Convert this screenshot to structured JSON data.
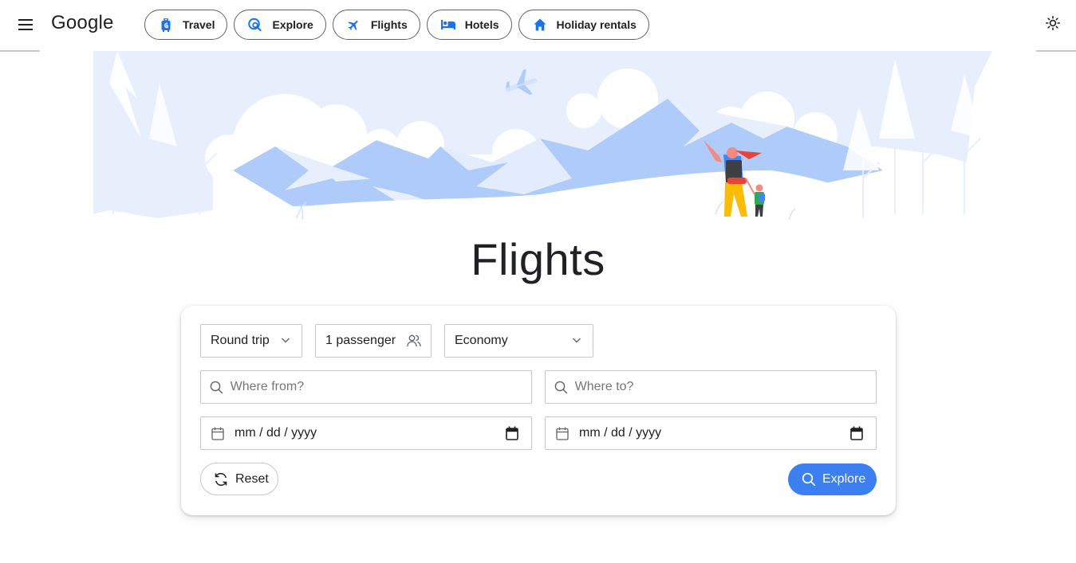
{
  "header": {
    "logo": "Google",
    "nav": [
      {
        "id": "travel",
        "label": "Travel"
      },
      {
        "id": "explore",
        "label": "Explore"
      },
      {
        "id": "flights",
        "label": "Flights"
      },
      {
        "id": "hotels",
        "label": "Hotels"
      },
      {
        "id": "holiday",
        "label": "Holiday rentals"
      }
    ],
    "icons": {
      "menu": "hamburger-menu-icon",
      "theme": "sun-icon"
    }
  },
  "page": {
    "title": "Flights"
  },
  "search": {
    "trip_type": "Round trip",
    "passengers": "1 passenger",
    "cabin_class": "Economy",
    "from_placeholder": "Where from?",
    "to_placeholder": "Where to?",
    "depart_date": "mm / dd / yyyy",
    "return_date": "mm / dd / yyyy",
    "reset_label": "Reset",
    "explore_label": "Explore"
  },
  "colors": {
    "accent": "#3b7ff1",
    "nav_icon": "#1a73e8",
    "hero_light": "#e8effc",
    "hero_mid": "#aecbfa"
  }
}
